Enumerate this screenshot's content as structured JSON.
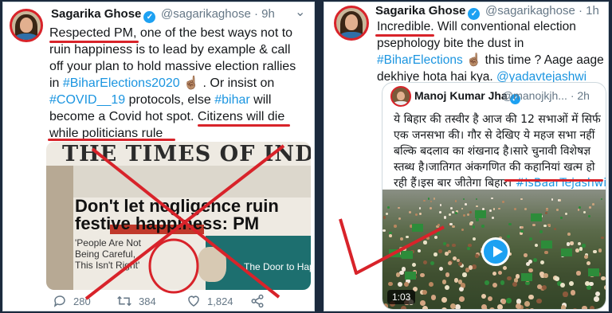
{
  "left_tweet": {
    "name": "Sagarika Ghose",
    "handle": "@sagarikaghose",
    "time": "· 9h",
    "lines": [
      {
        "before": "",
        "highlight": "Respected PM",
        "after": ", one of the best ways not to"
      },
      {
        "text": "ruin happiness is to lead by example & call"
      },
      {
        "text": "off your plan to hold massive election rallies"
      },
      {
        "prefix": "in ",
        "tag": "#BiharElections2020",
        "suffix": " ☝🏽 . Or insist on"
      },
      {
        "tag": "#COVID__19",
        "suffix": " protocols, else ",
        "tag2": "#bihar",
        "suffix2": " will"
      },
      {
        "before": "become a Covid hot spot. ",
        "highlight": "Citizens will die"
      },
      {
        "highlight": "while politicians rule"
      }
    ],
    "newspaper": {
      "masthead": "THE TIMES OF INDI",
      "headline_1": "Don't let negligence ruin",
      "headline_2": "festive happiness: PM",
      "quote_1": "'People Are Not",
      "quote_2": "Being Careful,",
      "quote_3": "This Isn't Right'",
      "ad_text": "The Door to Happin"
    },
    "actions": {
      "replies": "280",
      "retweets": "384",
      "likes": "1,824"
    }
  },
  "right_tweet": {
    "name": "Sagarika Ghose",
    "handle": "@sagarikaghose",
    "time": "· 1h",
    "lines": [
      {
        "highlight": "Incredible",
        "after": ". Will conventional election"
      },
      {
        "text": "psephology bite the dust in"
      },
      {
        "tag": "#BiharElections",
        "suffix": " ☝🏽 this time ? Aage aage"
      },
      {
        "prefix": "dekhiye hota hai kya. ",
        "tag": "@yadavtejashwi"
      }
    ],
    "quoted": {
      "name": "Manoj Kumar Jha",
      "handle": "@manojkjh...",
      "time": "· 2h",
      "lines": [
        "ये बिहार की तस्वीर है आज की 12 सभाओं में सिर्फ",
        "एक जनसभा की। गौर से देखिए ये महज सभा नहीं",
        "बल्कि बदलाव का शंखनाद है।सारे चुनावी विशेषज्ञ",
        "स्तब्ध है।जातिगत अंकगणित की कहानियां खत्म हो",
        "रही हैं।इस बार जीतेगा बिहार। "
      ],
      "hashtag": "#IsBaarTejashwi...",
      "video_duration": "1:03"
    }
  },
  "colors": {
    "annotation_red": "#d8232a",
    "link_blue": "#1b95e0",
    "verified_blue": "#1da1f2",
    "background": "#1b2a3d"
  }
}
